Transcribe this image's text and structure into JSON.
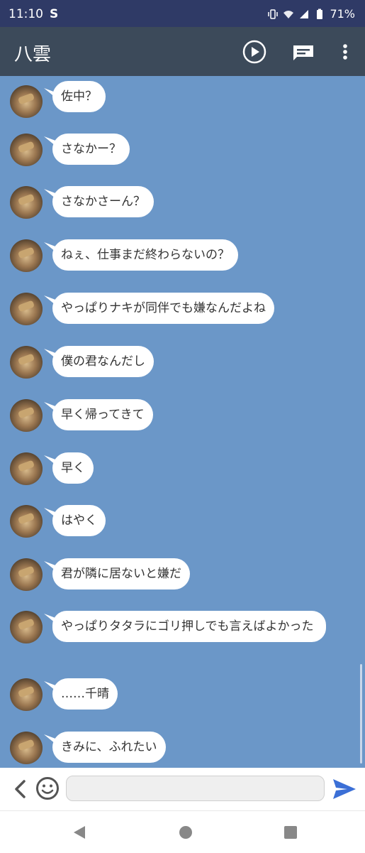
{
  "status_bar": {
    "time": "11:10",
    "s_icon": "S",
    "battery": "71%",
    "icons": [
      "vibrate-icon",
      "wifi-5g-icon",
      "signal-icon",
      "battery-icon"
    ]
  },
  "app_bar": {
    "title": "八雲",
    "icons": [
      "play-icon",
      "message-icon",
      "more-vert-icon"
    ]
  },
  "messages": [
    "佐中？",
    "さなかー？",
    "さなかさーん？",
    "ねぇ、仕事まだ終わらないの？",
    "やっぱりナキが同伴でも嫌なんだよね",
    "僕の君なんだし",
    "早く帰ってきて",
    "早く",
    "はやく",
    "君が隣に居ないと嫌だ",
    "やっぱりタタラにゴリ押しでも言えばよかった",
    "……千晴",
    "きみに、ふれたい"
  ],
  "input": {
    "placeholder": "",
    "value": ""
  },
  "colors": {
    "chat_bg": "#6b97c8",
    "app_bar": "#3c4a5a",
    "status_bar": "#2f3a66",
    "send": "#3b6fd6"
  }
}
